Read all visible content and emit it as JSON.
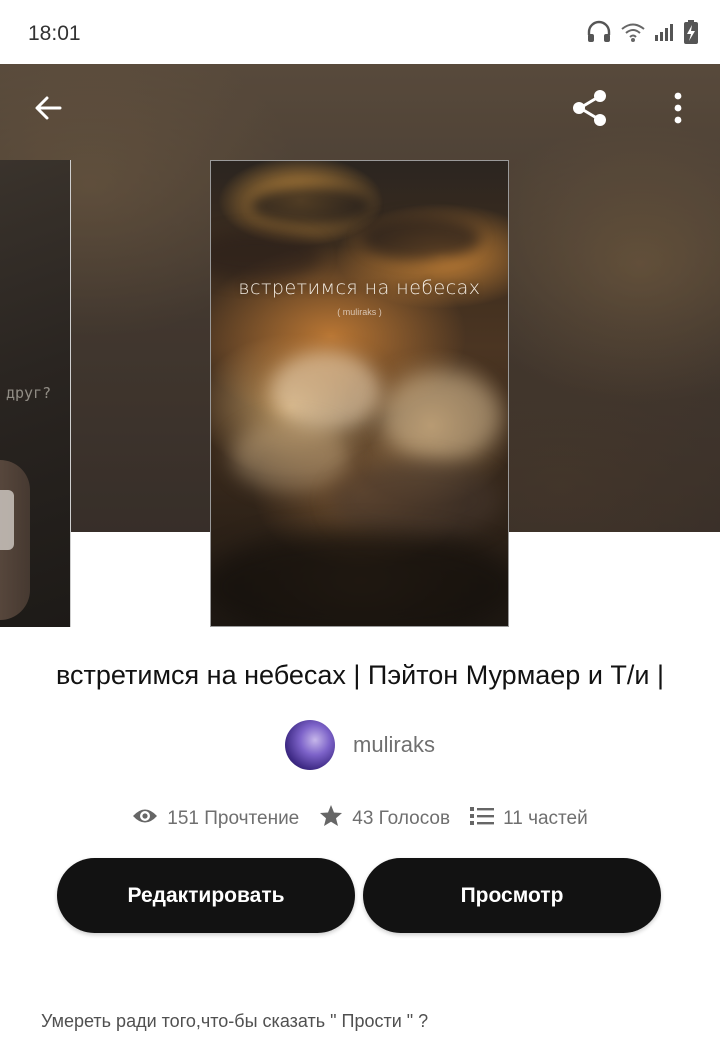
{
  "status_bar": {
    "time": "18:01",
    "icons": [
      "headphones-icon",
      "wifi-icon",
      "signal-icon",
      "battery-charging-icon"
    ]
  },
  "toolbar": {
    "back_icon": "arrow-back-icon",
    "share_icon": "share-icon",
    "more_icon": "more-vertical-icon"
  },
  "covers": {
    "main": {
      "title": "встретимся на небесах",
      "author": "( muliraks )"
    },
    "side": {
      "caption": "друг?"
    }
  },
  "story": {
    "title": "встретимся на небесах | Пэйтон Мурмаер и Т/и |",
    "author": "muliraks",
    "stats": {
      "reads": "151 Прочтение",
      "votes": "43 Голосов",
      "parts": "11 частей"
    },
    "description": "Умереть ради того,что-бы сказать \" Прости \" ?"
  },
  "actions": {
    "edit_label": "Редактировать",
    "view_label": "Просмотр"
  },
  "colors": {
    "button_bg": "#121212",
    "button_text": "#ffffff",
    "meta_text": "#6f6f6f"
  }
}
